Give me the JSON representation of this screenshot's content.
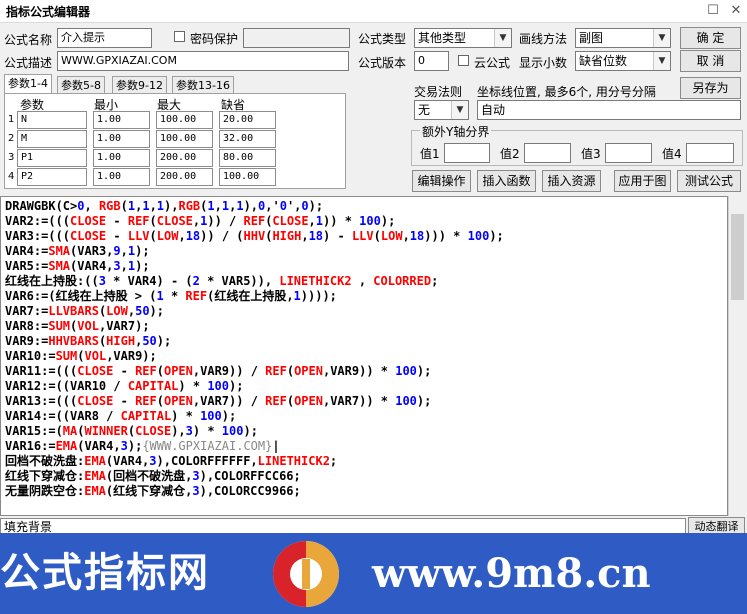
{
  "window": {
    "title": "指标公式编辑器",
    "close_glyph": "✕",
    "restore_glyph": "☐"
  },
  "form": {
    "name_label": "公式名称",
    "name_value": "介入提示",
    "password_label": "密码保护",
    "desc_label": "公式描述",
    "desc_value": "WWW.GPXIAZAI.COM",
    "type_label": "公式类型",
    "type_value": "其他类型",
    "draw_label": "画线方法",
    "draw_value": "副图",
    "version_label": "公式版本",
    "version_value": "0",
    "cloud_label": "云公式",
    "decimals_label": "显示小数",
    "decimals_value": "缺省位数"
  },
  "buttons": {
    "ok": "确  定",
    "cancel": "取  消",
    "save_as": "另存为"
  },
  "tabs": [
    "参数1-4",
    "参数5-8",
    "参数9-12",
    "参数13-16"
  ],
  "params": {
    "headers": [
      "参数",
      "最小",
      "最大",
      "缺省"
    ],
    "rows": [
      {
        "n": "1",
        "name": "N",
        "min": "1.00",
        "max": "100.00",
        "def": "20.00"
      },
      {
        "n": "2",
        "name": "M",
        "min": "1.00",
        "max": "100.00",
        "def": "32.00"
      },
      {
        "n": "3",
        "name": "P1",
        "min": "1.00",
        "max": "200.00",
        "def": "80.00"
      },
      {
        "n": "4",
        "name": "P2",
        "min": "1.00",
        "max": "200.00",
        "def": "100.00"
      }
    ]
  },
  "trade": {
    "rule_label": "交易法则",
    "rule_value": "无",
    "axis_label": "坐标线位置, 最多6个, 用分号分隔",
    "axis_value": "自动",
    "extra_axis_label": "额外Y轴分界",
    "value_labels": [
      "值1",
      "值2",
      "值3",
      "值4"
    ]
  },
  "actions": [
    "编辑操作",
    "插入函数",
    "插入资源",
    "应用于图",
    "测试公式"
  ],
  "code": [
    [
      [
        "DRAWGBK(C>",
        "k"
      ],
      [
        "0",
        "b"
      ],
      [
        ", ",
        "k"
      ],
      [
        "RGB",
        "r"
      ],
      [
        "(",
        "k"
      ],
      [
        "1",
        "b"
      ],
      [
        ",",
        "k"
      ],
      [
        "1",
        "b"
      ],
      [
        ",",
        "k"
      ],
      [
        "1",
        "b"
      ],
      [
        "),",
        "k"
      ],
      [
        "RGB",
        "r"
      ],
      [
        "(",
        "k"
      ],
      [
        "1",
        "b"
      ],
      [
        ",",
        "k"
      ],
      [
        "1",
        "b"
      ],
      [
        ",",
        "k"
      ],
      [
        "1",
        "b"
      ],
      [
        "),",
        "k"
      ],
      [
        "0",
        "b"
      ],
      [
        ",'",
        "k"
      ],
      [
        "0",
        "b"
      ],
      [
        "',",
        "k"
      ],
      [
        "0",
        "b"
      ],
      [
        ");",
        "k"
      ]
    ],
    [
      [
        "VAR2:=(((",
        "k"
      ],
      [
        "CLOSE",
        "r"
      ],
      [
        " - ",
        "k"
      ],
      [
        "REF",
        "r"
      ],
      [
        "(",
        "k"
      ],
      [
        "CLOSE",
        "r"
      ],
      [
        ",",
        "k"
      ],
      [
        "1",
        "b"
      ],
      [
        "))",
        "k"
      ],
      [
        " / ",
        "k"
      ],
      [
        "REF",
        "r"
      ],
      [
        "(",
        "k"
      ],
      [
        "CLOSE",
        "r"
      ],
      [
        ",",
        "k"
      ],
      [
        "1",
        "b"
      ],
      [
        "))",
        "k"
      ],
      [
        " * ",
        "k"
      ],
      [
        "100",
        "b"
      ],
      [
        ");",
        "k"
      ]
    ],
    [
      [
        "VAR3:=(((",
        "k"
      ],
      [
        "CLOSE",
        "r"
      ],
      [
        " - ",
        "k"
      ],
      [
        "LLV",
        "r"
      ],
      [
        "(",
        "k"
      ],
      [
        "LOW",
        "r"
      ],
      [
        ",",
        "k"
      ],
      [
        "18",
        "b"
      ],
      [
        "))",
        "k"
      ],
      [
        " / ",
        "k"
      ],
      [
        "(",
        "k"
      ],
      [
        "HHV",
        "r"
      ],
      [
        "(",
        "k"
      ],
      [
        "HIGH",
        "r"
      ],
      [
        ",",
        "k"
      ],
      [
        "18",
        "b"
      ],
      [
        ")",
        "k"
      ],
      [
        " - ",
        "k"
      ],
      [
        "LLV",
        "r"
      ],
      [
        "(",
        "k"
      ],
      [
        "LOW",
        "r"
      ],
      [
        ",",
        "k"
      ],
      [
        "18",
        "b"
      ],
      [
        ")))",
        "k"
      ],
      [
        " * ",
        "k"
      ],
      [
        "100",
        "b"
      ],
      [
        ");",
        "k"
      ]
    ],
    [
      [
        "VAR4:=",
        "k"
      ],
      [
        "SMA",
        "r"
      ],
      [
        "(VAR3,",
        "k"
      ],
      [
        "9",
        "b"
      ],
      [
        ",",
        "k"
      ],
      [
        "1",
        "b"
      ],
      [
        ");",
        "k"
      ]
    ],
    [
      [
        "VAR5:=",
        "k"
      ],
      [
        "SMA",
        "r"
      ],
      [
        "(VAR4,",
        "k"
      ],
      [
        "3",
        "b"
      ],
      [
        ",",
        "k"
      ],
      [
        "1",
        "b"
      ],
      [
        ");",
        "k"
      ]
    ],
    [
      [
        "红线在上持股:((",
        "k"
      ],
      [
        "3",
        "b"
      ],
      [
        " * VAR4) - (",
        "k"
      ],
      [
        "2",
        "b"
      ],
      [
        " * VAR5)), ",
        "k"
      ],
      [
        "LINETHICK2",
        "r"
      ],
      [
        " , ",
        "k"
      ],
      [
        "COLORRED",
        "r"
      ],
      [
        ";",
        "k"
      ]
    ],
    [
      [
        "VAR6:=(红线在上持股 > (",
        "k"
      ],
      [
        "1",
        "b"
      ],
      [
        " * ",
        "k"
      ],
      [
        "REF",
        "r"
      ],
      [
        "(红线在上持股,",
        "k"
      ],
      [
        "1",
        "b"
      ],
      [
        "))));",
        "k"
      ]
    ],
    [
      [
        "VAR7:=",
        "k"
      ],
      [
        "LLVBARS",
        "r"
      ],
      [
        "(",
        "k"
      ],
      [
        "LOW",
        "r"
      ],
      [
        ",",
        "k"
      ],
      [
        "50",
        "b"
      ],
      [
        ");",
        "k"
      ]
    ],
    [
      [
        "VAR8:=",
        "k"
      ],
      [
        "SUM",
        "r"
      ],
      [
        "(",
        "k"
      ],
      [
        "VOL",
        "r"
      ],
      [
        ",VAR7);",
        "k"
      ]
    ],
    [
      [
        "VAR9:=",
        "k"
      ],
      [
        "HHVBARS",
        "r"
      ],
      [
        "(",
        "k"
      ],
      [
        "HIGH",
        "r"
      ],
      [
        ",",
        "k"
      ],
      [
        "50",
        "b"
      ],
      [
        ");",
        "k"
      ]
    ],
    [
      [
        "VAR10:=",
        "k"
      ],
      [
        "SUM",
        "r"
      ],
      [
        "(",
        "k"
      ],
      [
        "VOL",
        "r"
      ],
      [
        ",VAR9);",
        "k"
      ]
    ],
    [
      [
        "VAR11:=(((",
        "k"
      ],
      [
        "CLOSE",
        "r"
      ],
      [
        " - ",
        "k"
      ],
      [
        "REF",
        "r"
      ],
      [
        "(",
        "k"
      ],
      [
        "OPEN",
        "r"
      ],
      [
        ",VAR9)) / ",
        "k"
      ],
      [
        "REF",
        "r"
      ],
      [
        "(",
        "k"
      ],
      [
        "OPEN",
        "r"
      ],
      [
        ",VAR9)) * ",
        "k"
      ],
      [
        "100",
        "b"
      ],
      [
        ");",
        "k"
      ]
    ],
    [
      [
        "VAR12:=((VAR10 / ",
        "k"
      ],
      [
        "CAPITAL",
        "r"
      ],
      [
        ") * ",
        "k"
      ],
      [
        "100",
        "b"
      ],
      [
        ");",
        "k"
      ]
    ],
    [
      [
        "VAR13:=(((",
        "k"
      ],
      [
        "CLOSE",
        "r"
      ],
      [
        " - ",
        "k"
      ],
      [
        "REF",
        "r"
      ],
      [
        "(",
        "k"
      ],
      [
        "OPEN",
        "r"
      ],
      [
        ",VAR7)) / ",
        "k"
      ],
      [
        "REF",
        "r"
      ],
      [
        "(",
        "k"
      ],
      [
        "OPEN",
        "r"
      ],
      [
        ",VAR7)) * ",
        "k"
      ],
      [
        "100",
        "b"
      ],
      [
        ");",
        "k"
      ]
    ],
    [
      [
        "VAR14:=((VAR8 / ",
        "k"
      ],
      [
        "CAPITAL",
        "r"
      ],
      [
        ") * ",
        "k"
      ],
      [
        "100",
        "b"
      ],
      [
        ");",
        "k"
      ]
    ],
    [
      [
        "VAR15:=(",
        "k"
      ],
      [
        "MA",
        "r"
      ],
      [
        "(",
        "k"
      ],
      [
        "WINNER",
        "r"
      ],
      [
        "(",
        "k"
      ],
      [
        "CLOSE",
        "r"
      ],
      [
        "),",
        "k"
      ],
      [
        "3",
        "b"
      ],
      [
        ") * ",
        "k"
      ],
      [
        "100",
        "b"
      ],
      [
        ");",
        "k"
      ]
    ],
    [
      [
        "VAR16:=",
        "k"
      ],
      [
        "EMA",
        "r"
      ],
      [
        "(VAR4,",
        "k"
      ],
      [
        "3",
        "b"
      ],
      [
        ");",
        "k"
      ],
      [
        "{WWW.GPXIAZAI.COM}",
        "g"
      ],
      [
        "|",
        "k"
      ]
    ],
    [
      [
        "回档不破洗盘:",
        "k"
      ],
      [
        "EMA",
        "r"
      ],
      [
        "(VAR4,",
        "k"
      ],
      [
        "3",
        "b"
      ],
      [
        "),COLORFFFFFF,",
        "k"
      ],
      [
        "LINETHICK2",
        "r"
      ],
      [
        ";",
        "k"
      ]
    ],
    [
      [
        "红线下穿减仓:",
        "k"
      ],
      [
        "EMA",
        "r"
      ],
      [
        "(回档不破洗盘,",
        "k"
      ],
      [
        "3",
        "b"
      ],
      [
        "),COLORFFCC66;",
        "k"
      ]
    ],
    [
      [
        "无量阴跌空仓:",
        "k"
      ],
      [
        "EMA",
        "r"
      ],
      [
        "(红线下穿减仓,",
        "k"
      ],
      [
        "3",
        "b"
      ],
      [
        "),COLORCC9966;",
        "k"
      ]
    ]
  ],
  "status": {
    "text": "填充背景",
    "translate": "动态翻译"
  },
  "banner": {
    "left": "公式指标网",
    "right": "www.9m8.cn"
  },
  "colors": {
    "keyword": "#ff0000",
    "number": "#0000ff",
    "comment": "#888888",
    "banner": "#2f5cc4"
  }
}
